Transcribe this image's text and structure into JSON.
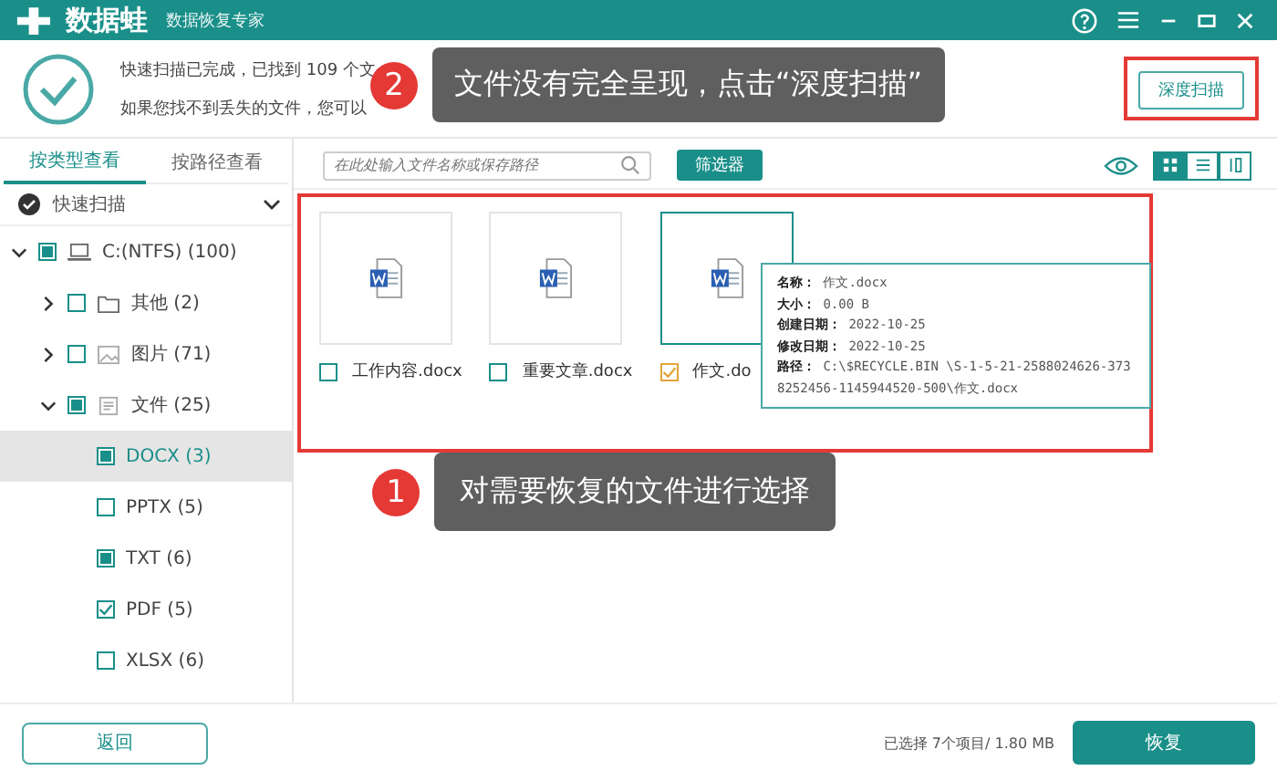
{
  "title_bar": {
    "app_name": "数据蛙",
    "subtitle": "数据恢复专家"
  },
  "scan_summary": {
    "line_1": "快速扫描已完成，已找到 109 个文",
    "line_2": "如果您找不到丢失的文件，您可以"
  },
  "deep_scan_button": "深度扫描",
  "callouts": [
    {
      "number": "2",
      "text": "文件没有完全呈现，点击“深度扫描”"
    },
    {
      "number": "1",
      "text": "对需要恢复的文件进行选择"
    }
  ],
  "view_tabs": [
    {
      "label": "按类型查看",
      "selected": true
    },
    {
      "label": "按路径查看",
      "selected": false
    }
  ],
  "scan_mode": "快速扫描",
  "tree": [
    {
      "label": "C:(NTFS) (100)",
      "kind": "drive",
      "checked": false,
      "partial": true,
      "expanded": true,
      "selected": false,
      "children": [
        {
          "label": "其他 (2)",
          "kind": "folder",
          "checked": false,
          "partial": false,
          "expanded": false,
          "selected": false
        },
        {
          "label": "图片 (71)",
          "kind": "image",
          "checked": false,
          "partial": false,
          "expanded": false,
          "selected": false
        },
        {
          "label": "文件 (25)",
          "kind": "document",
          "checked": false,
          "partial": true,
          "expanded": true,
          "selected": false,
          "children": [
            {
              "label": "DOCX (3)",
              "checked": false,
              "partial": true,
              "selected": true
            },
            {
              "label": "PPTX (5)",
              "checked": false,
              "partial": false,
              "selected": false
            },
            {
              "label": "TXT (6)",
              "checked": false,
              "partial": true,
              "selected": false
            },
            {
              "label": "PDF (5)",
              "checked": true,
              "partial": false,
              "selected": false
            },
            {
              "label": "XLSX (6)",
              "checked": false,
              "partial": false,
              "selected": false
            }
          ]
        }
      ]
    }
  ],
  "search": {
    "placeholder": "在此处输入文件名称或保存路径"
  },
  "filter_button": "筛选器",
  "view_modes": [
    {
      "kind": "grid",
      "selected": true
    },
    {
      "kind": "list",
      "selected": false
    },
    {
      "kind": "columns",
      "selected": false
    }
  ],
  "files": [
    {
      "name": "工作内容.docx",
      "checked": false,
      "selected": false
    },
    {
      "name": "重要文章.docx",
      "checked": false,
      "selected": false
    },
    {
      "name": "作文.do",
      "checked": true,
      "selected": true
    }
  ],
  "tooltip": [
    {
      "label": "名称：",
      "value": "作文.docx"
    },
    {
      "label": "大小：",
      "value": "0.00 B"
    },
    {
      "label": "创建日期：",
      "value": "2022-10-25"
    },
    {
      "label": "修改日期：",
      "value": "2022-10-25"
    },
    {
      "label": "路径：",
      "value": "C:\\$RECYCLE.BIN \\S-1-5-21-2588024626-3738252456-1145944520-500\\作文.docx"
    }
  ],
  "footer": {
    "back_button": "返回",
    "selection_summary": "已选择 7个项目/ 1.80 MB",
    "restore_button": "恢复"
  }
}
